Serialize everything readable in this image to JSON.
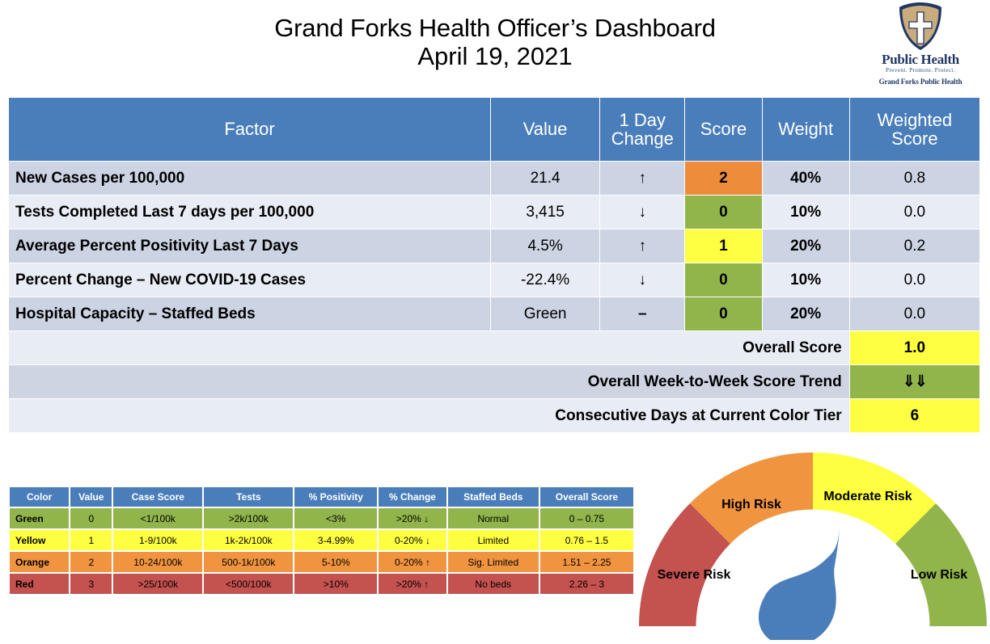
{
  "title": {
    "heading": "Grand Forks Health Officer’s Dashboard",
    "date": "April 19, 2021"
  },
  "logo": {
    "wordmark": "Public Health",
    "tagline": "Prevent. Promote. Protect.",
    "org": "Grand Forks Public Health"
  },
  "main_table": {
    "headers": {
      "factor": "Factor",
      "value": "Value",
      "change": "1 Day Change",
      "change_line1": "1 Day",
      "change_line2": "Change",
      "score": "Score",
      "weight": "Weight",
      "weighted_line1": "Weighted",
      "weighted_line2": "Score"
    },
    "rows": [
      {
        "factor": "New Cases per 100,000",
        "value": "21.4",
        "change": "↑",
        "score": "2",
        "score_color": "#ed8c3b",
        "weight": "40%",
        "weighted": "0.8"
      },
      {
        "factor": "Tests Completed Last 7 days per 100,000",
        "value": "3,415",
        "change": "↓",
        "score": "0",
        "score_color": "#91b44b",
        "weight": "10%",
        "weighted": "0.0"
      },
      {
        "factor": "Average Percent Positivity Last 7 Days",
        "value": "4.5%",
        "change": "↑",
        "score": "1",
        "score_color": "#ffff41",
        "weight": "20%",
        "weighted": "0.2"
      },
      {
        "factor": "Percent Change – New COVID-19 Cases",
        "value": "-22.4%",
        "change": "↓",
        "score": "0",
        "score_color": "#91b44b",
        "weight": "10%",
        "weighted": "0.0"
      },
      {
        "factor": "Hospital Capacity – Staffed Beds",
        "value": "Green",
        "change": "–",
        "score": "0",
        "score_color": "#91b44b",
        "weight": "20%",
        "weighted": "0.0"
      }
    ],
    "summary": [
      {
        "label": "Overall Score",
        "value": "1.0",
        "value_color": "#ffff41"
      },
      {
        "label": "Overall Week-to-Week Score Trend",
        "value": "⇓⇓",
        "value_color": "#91b44b"
      },
      {
        "label": "Consecutive Days at Current Color Tier",
        "value": "6",
        "value_color": "#ffff41"
      }
    ]
  },
  "legend_table": {
    "headers": [
      "Color",
      "Value",
      "Case Score",
      "Tests",
      "% Positivity",
      "% Change",
      "Staffed Beds",
      "Overall Score"
    ],
    "rows": [
      {
        "color": "Green",
        "hex": "#91b44b",
        "value": "0",
        "case_score": "<1/100k",
        "tests": ">2k/100k",
        "positivity": "<3%",
        "change": ">20% ↓",
        "beds": "Normal",
        "overall": "0 – 0.75"
      },
      {
        "color": "Yellow",
        "hex": "#ffff41",
        "value": "1",
        "case_score": "1-9/100k",
        "tests": "1k-2k/100k",
        "positivity": "3-4.99%",
        "change": "0-20% ↓",
        "beds": "Limited",
        "overall": "0.76 – 1.5"
      },
      {
        "color": "Orange",
        "hex": "#f0943f",
        "value": "2",
        "case_score": "10-24/100k",
        "tests": "500-1k/100k",
        "positivity": "5-10%",
        "change": "0-20% ↑",
        "beds": "Sig. Limited",
        "overall": "1.51 – 2.25"
      },
      {
        "color": "Red",
        "hex": "#c4524f",
        "value": "3",
        "case_score": ">25/100k",
        "tests": "<500/100k",
        "positivity": ">10%",
        "change": ">20% ↑",
        "beds": "No beds",
        "overall": "2.26 – 3"
      }
    ]
  },
  "gauge": {
    "segments": [
      {
        "label": "Severe Risk",
        "color": "#c4524f"
      },
      {
        "label": "High Risk",
        "color": "#f0943f"
      },
      {
        "label": "Moderate Risk",
        "color": "#ffff41"
      },
      {
        "label": "Low Risk",
        "color": "#91b44b"
      }
    ],
    "needle_color": "#4a7ebb",
    "needle_points_to": "Moderate Risk"
  },
  "colors": {
    "header_blue": "#4a7ebb",
    "row_dark": "#ccd3e3",
    "row_light": "#e8ecf4",
    "green": "#91b44b",
    "yellow": "#ffff41",
    "orange": "#ed8c3b",
    "red": "#c4524f"
  }
}
